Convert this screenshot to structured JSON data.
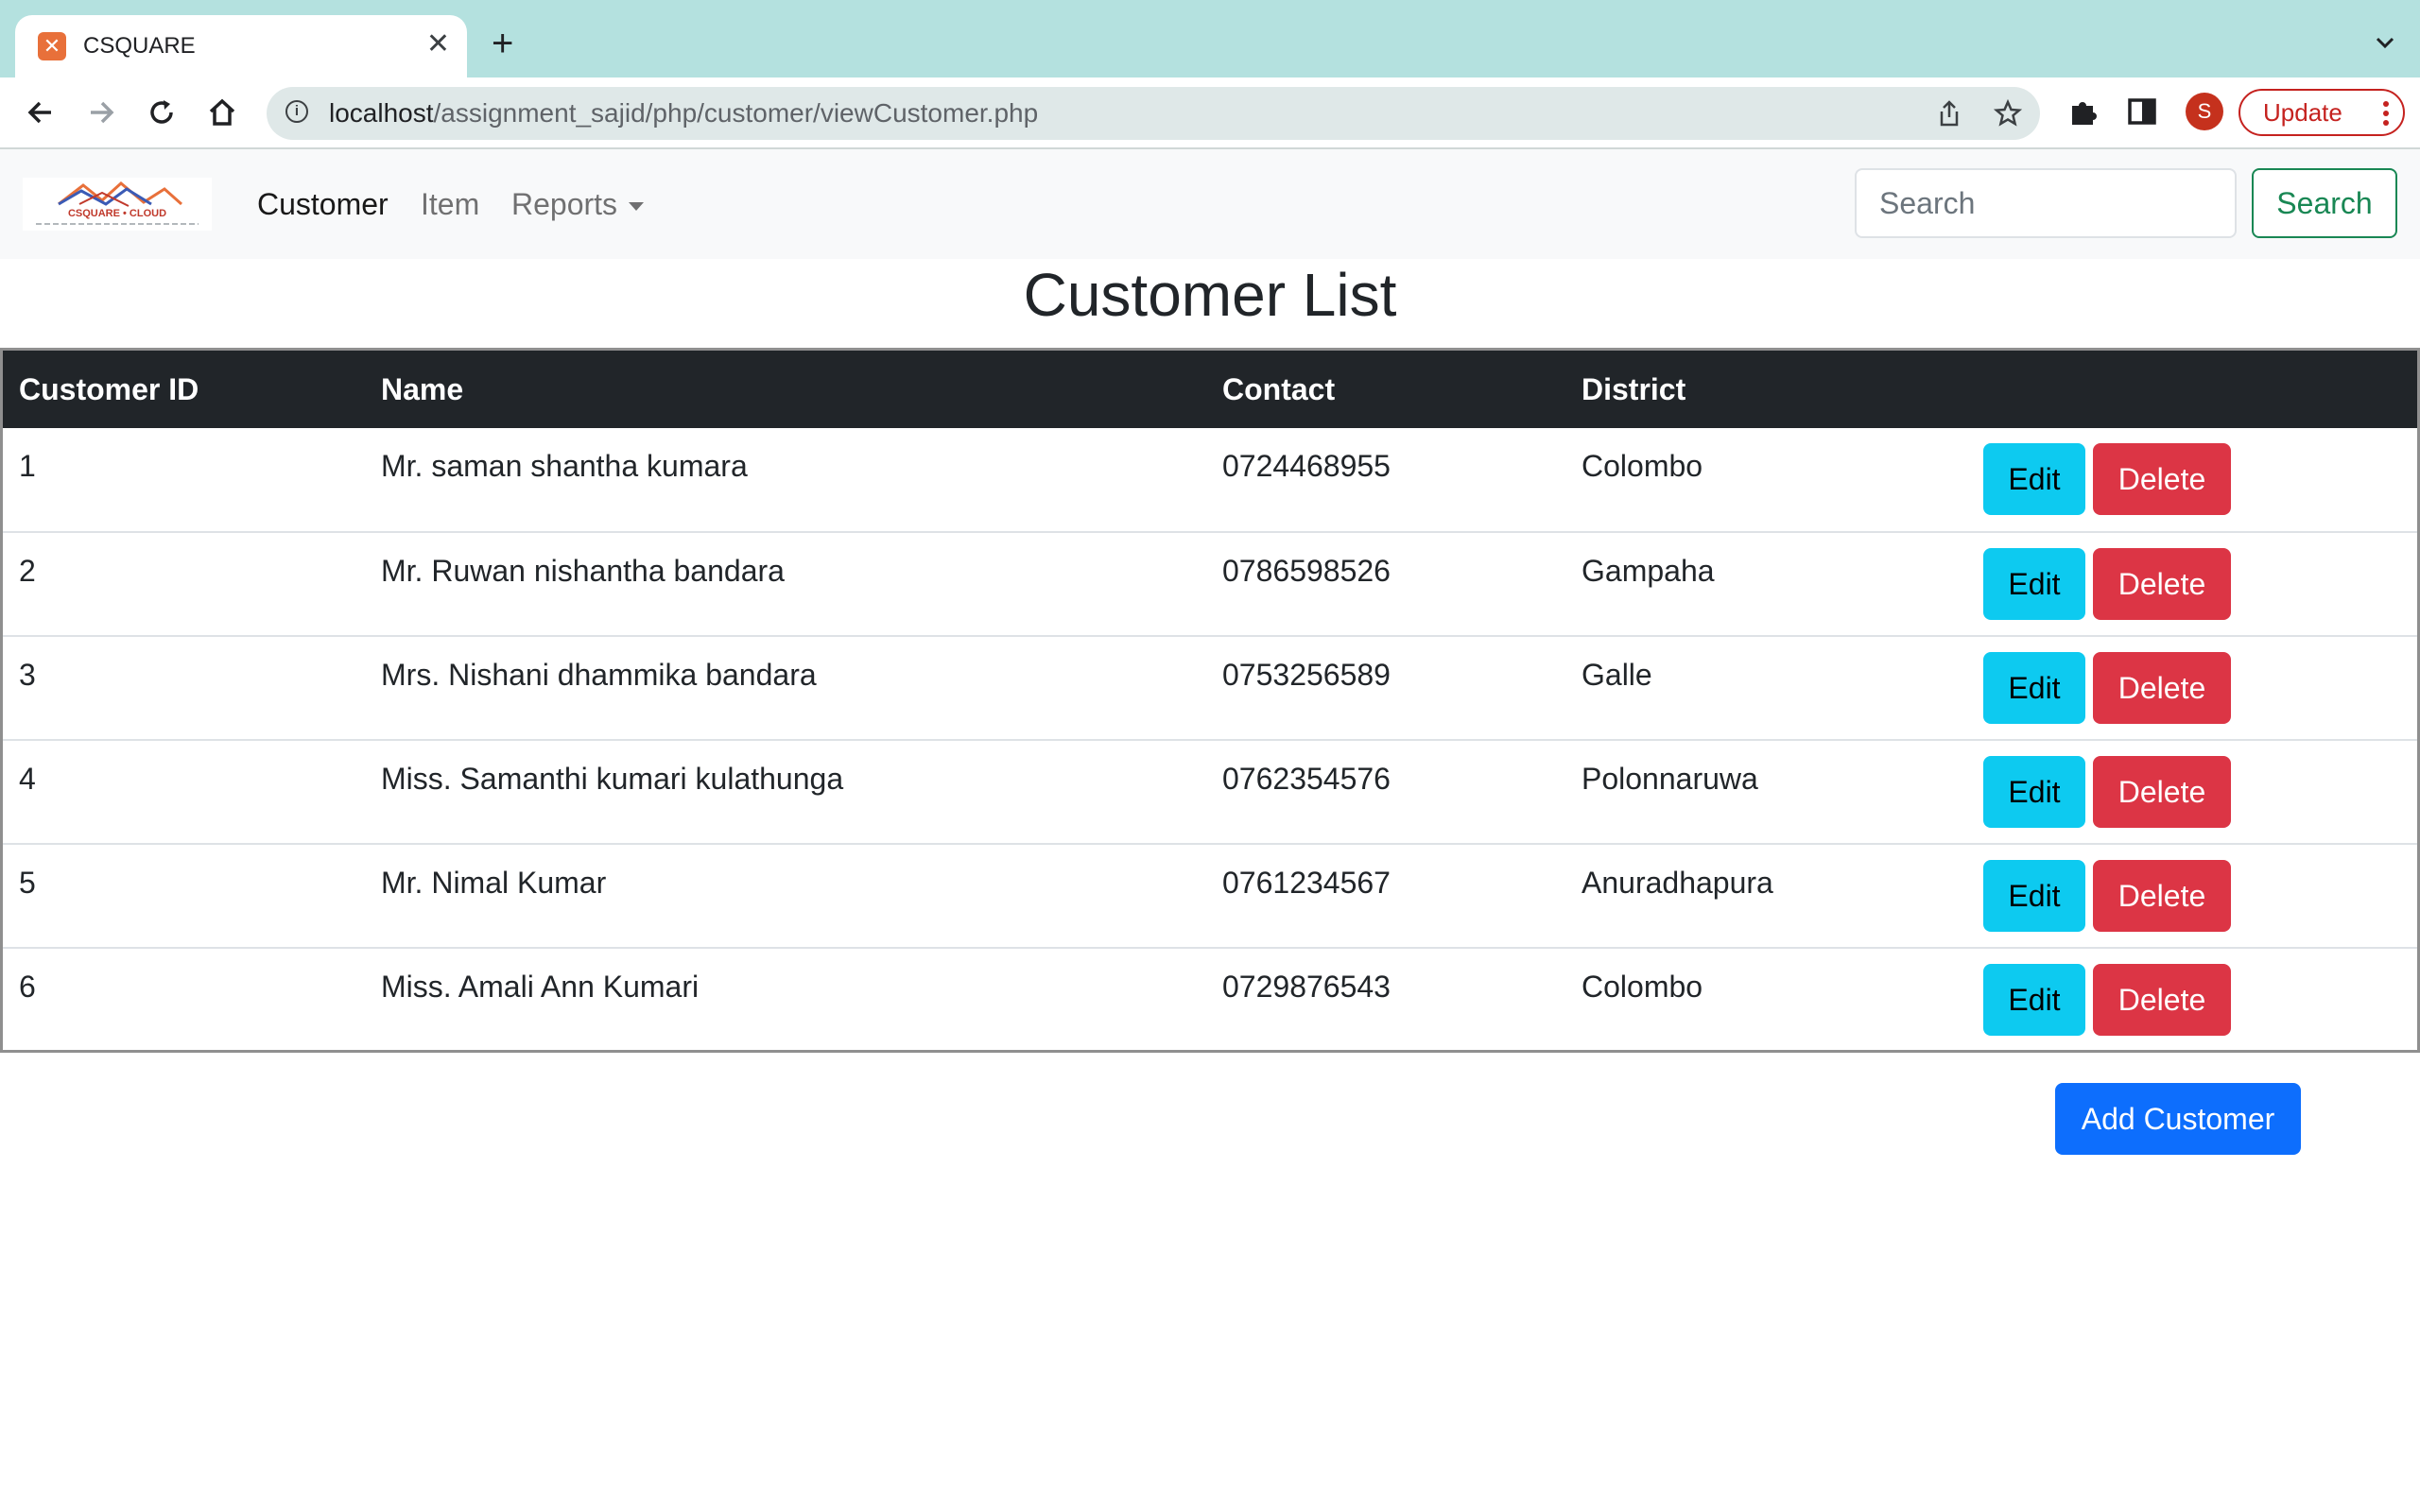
{
  "browser": {
    "tab_title": "CSQUARE",
    "url_host": "localhost",
    "url_path": "/assignment_sajid/php/customer/viewCustomer.php",
    "profile_initial": "S",
    "update_label": "Update"
  },
  "navbar": {
    "logo_alt": "CSQUARE • CLOUD",
    "links": [
      "Customer",
      "Item",
      "Reports"
    ],
    "active_link": "Customer",
    "search_placeholder": "Search",
    "search_button": "Search"
  },
  "page": {
    "title": "Customer List",
    "add_button": "Add Customer"
  },
  "table": {
    "columns": [
      "Customer ID",
      "Name",
      "Contact",
      "District",
      ""
    ],
    "edit_label": "Edit",
    "delete_label": "Delete",
    "rows": [
      {
        "id": "1",
        "name": "Mr. saman shantha kumara",
        "contact": "0724468955",
        "district": "Colombo"
      },
      {
        "id": "2",
        "name": "Mr. Ruwan nishantha bandara",
        "contact": "0786598526",
        "district": "Gampaha"
      },
      {
        "id": "3",
        "name": "Mrs. Nishani dhammika bandara",
        "contact": "0753256589",
        "district": "Galle"
      },
      {
        "id": "4",
        "name": "Miss. Samanthi kumari kulathunga",
        "contact": "0762354576",
        "district": "Polonnaruwa"
      },
      {
        "id": "5",
        "name": "Mr. Nimal Kumar",
        "contact": "0761234567",
        "district": "Anuradhapura"
      },
      {
        "id": "6",
        "name": "Miss. Amali Ann Kumari",
        "contact": "0729876543",
        "district": "Colombo"
      }
    ]
  },
  "colors": {
    "tab_strip": "#b4e1df",
    "table_header": "#212529",
    "edit_button": "#0dcaf0",
    "delete_button": "#dc3545",
    "add_button": "#0d6efd",
    "search_button": "#198754"
  }
}
